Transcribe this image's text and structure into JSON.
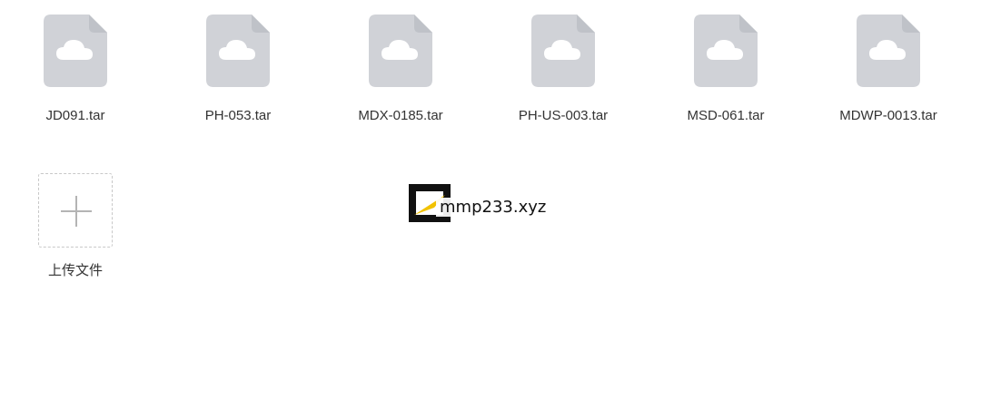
{
  "files": [
    {
      "name": "JD091.tar",
      "icon": "cloud-file-icon"
    },
    {
      "name": "PH-053.tar",
      "icon": "cloud-file-icon"
    },
    {
      "name": "MDX-0185.tar",
      "icon": "cloud-file-icon"
    },
    {
      "name": "PH-US-003.tar",
      "icon": "cloud-file-icon"
    },
    {
      "name": "MSD-061.tar",
      "icon": "cloud-file-icon"
    },
    {
      "name": "MDWP-0013.tar",
      "icon": "cloud-file-icon"
    }
  ],
  "upload": {
    "label": "上传文件",
    "icon": "plus-icon"
  },
  "watermark": {
    "text": "mmp233.xyz"
  },
  "colors": {
    "file_icon_fill": "#d0d2d7",
    "cloud": "#ffffff",
    "text": "#333333",
    "upload_border": "#c8c8c8",
    "plus": "#b4b4b4"
  }
}
